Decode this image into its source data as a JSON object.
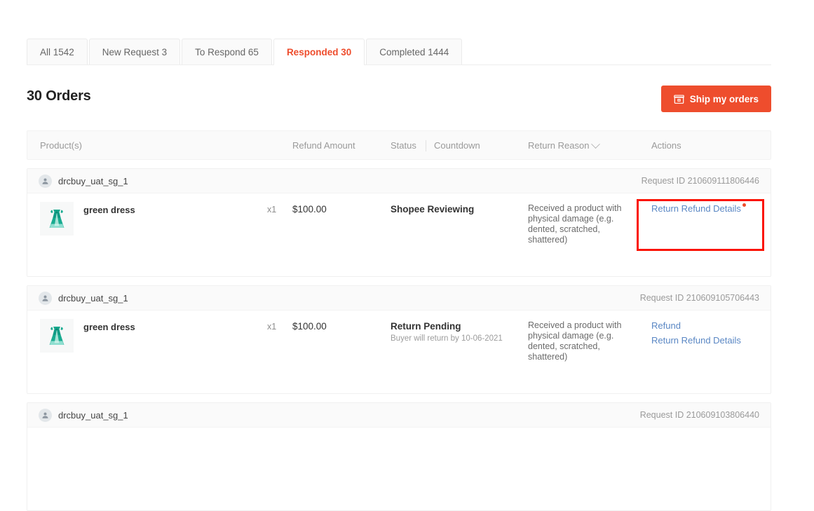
{
  "tabs": [
    {
      "label": "All 1542",
      "active": false
    },
    {
      "label": "New Request 3",
      "active": false
    },
    {
      "label": "To Respond 65",
      "active": false
    },
    {
      "label": "Responded 30",
      "active": true
    },
    {
      "label": "Completed 1444",
      "active": false
    }
  ],
  "header": {
    "orders_title": "30 Orders",
    "ship_button_label": "Ship my orders",
    "ship_button_icon": "package-box-icon",
    "accent_color": "#ee4d2d"
  },
  "table": {
    "columns": {
      "product": "Product(s)",
      "refund_amount": "Refund Amount",
      "status": "Status",
      "countdown": "Countdown",
      "return_reason": "Return Reason",
      "return_reason_icon": "chevron-down-icon",
      "actions": "Actions"
    }
  },
  "orders": [
    {
      "buyer": "drcbuy_uat_sg_1",
      "avatar_icon": "user-avatar-icon",
      "request_id": "Request ID 210609111806446",
      "product_name": "green dress",
      "product_thumb_icon": "green-dress-thumbnail",
      "quantity": "x1",
      "refund_amount": "$100.00",
      "status": "Shopee Reviewing",
      "countdown": "",
      "return_reason": "Received a product with physical damage (e.g. dented, scratched, shattered)",
      "actions": [
        {
          "label": "Return Refund Details",
          "badge": true
        }
      ],
      "highlighted": true
    },
    {
      "buyer": "drcbuy_uat_sg_1",
      "avatar_icon": "user-avatar-icon",
      "request_id": "Request ID 210609105706443",
      "product_name": "green dress",
      "product_thumb_icon": "green-dress-thumbnail",
      "quantity": "x1",
      "refund_amount": "$100.00",
      "status": "Return Pending",
      "countdown": "Buyer will return by 10-06-2021",
      "return_reason": "Received a product with physical damage (e.g. dented, scratched, shattered)",
      "actions": [
        {
          "label": "Refund",
          "badge": false
        },
        {
          "label": "Return Refund Details",
          "badge": false
        }
      ],
      "highlighted": false
    },
    {
      "buyer": "drcbuy_uat_sg_1",
      "avatar_icon": "user-avatar-icon",
      "request_id": "Request ID 210609103806440",
      "product_name": "",
      "product_thumb_icon": "",
      "quantity": "",
      "refund_amount": "",
      "status": "",
      "countdown": "",
      "return_reason": "",
      "actions": [],
      "highlighted": false
    }
  ],
  "highlight": {
    "color": "#fb1405",
    "target": "return-refund-details-link"
  }
}
